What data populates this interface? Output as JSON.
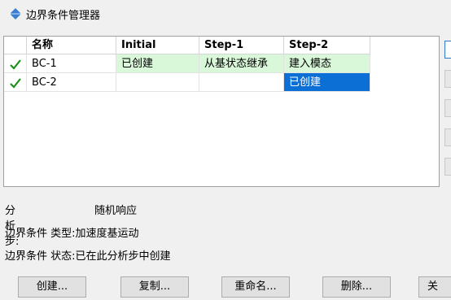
{
  "window": {
    "title": "边界条件管理器",
    "icon": "bc-manager-icon"
  },
  "table": {
    "columns": [
      "名称",
      "Initial",
      "Step-1",
      "Step-2"
    ],
    "rows": [
      {
        "checked": true,
        "name": "BC-1",
        "initial": "已创建",
        "step1": "从基状态继承",
        "step2": "建入模态"
      },
      {
        "checked": true,
        "name": "BC-2",
        "initial": "",
        "step1": "",
        "step2": "已创建"
      }
    ],
    "colors": {
      "green_cell": "#d9f7d9",
      "selected_cell": "#0c6fd6",
      "check": "#1a8f1a"
    }
  },
  "info": {
    "step_label": "分析步:",
    "step_value": "随机响应",
    "type_label": "边界条件 类型:",
    "type_value": "加速度基运动",
    "status_label": "边界条件 状态:",
    "status_value": "已在此分析步中创建"
  },
  "buttons": {
    "create": "创建...",
    "copy": "复制...",
    "rename": "重命名...",
    "delete": "删除...",
    "partial": "关"
  }
}
